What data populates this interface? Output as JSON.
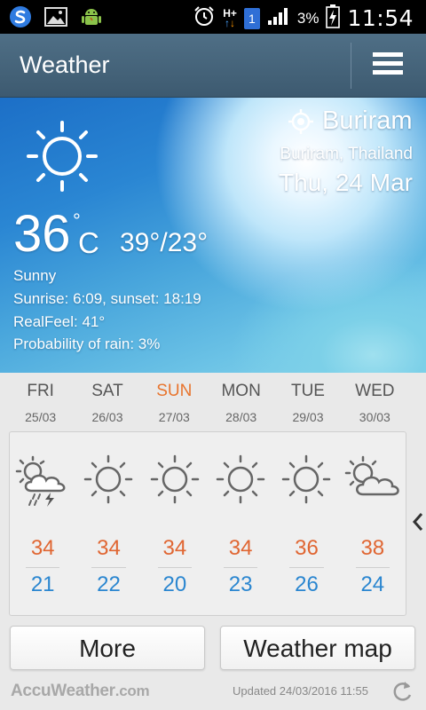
{
  "status_bar": {
    "battery": "3%",
    "time": "11:54",
    "network": "H+",
    "sim": "1",
    "icons": [
      "s-app-icon",
      "gallery-icon",
      "android-icon",
      "alarm-icon",
      "signal-icon",
      "battery-charging-icon"
    ]
  },
  "appbar": {
    "title": "Weather",
    "menu_icon": "hamburger-menu-icon"
  },
  "current": {
    "city": "Buriram",
    "region": "Buriram, Thailand",
    "date": "Thu, 24 Mar",
    "temp": "36",
    "temp_deg": "°",
    "unit": "C",
    "hilo": "39°/23°",
    "condition": "Sunny",
    "sunrise_sunset": "Sunrise: 6:09, sunset: 18:19",
    "realfeel": "RealFeel: 41°",
    "rain": "Probability of rain: 3%",
    "icon": "sun-icon"
  },
  "forecast": [
    {
      "day": "FRI",
      "date": "25/03",
      "icon": "thunderstorm-icon",
      "high": "34",
      "low": "21",
      "weekend": false
    },
    {
      "day": "SAT",
      "date": "26/03",
      "icon": "sun-icon",
      "high": "34",
      "low": "22",
      "weekend": false
    },
    {
      "day": "SUN",
      "date": "27/03",
      "icon": "sun-icon",
      "high": "34",
      "low": "20",
      "weekend": true
    },
    {
      "day": "MON",
      "date": "28/03",
      "icon": "sun-icon",
      "high": "34",
      "low": "23",
      "weekend": false
    },
    {
      "day": "TUE",
      "date": "29/03",
      "icon": "sun-icon",
      "high": "36",
      "low": "26",
      "weekend": false
    },
    {
      "day": "WED",
      "date": "30/03",
      "icon": "partly-cloudy-icon",
      "high": "38",
      "low": "24",
      "weekend": false
    }
  ],
  "buttons": {
    "more": "More",
    "map": "Weather map"
  },
  "footer": {
    "brand": "AccuWeather",
    "brand_suffix": ".com",
    "updated": "Updated 24/03/2016 11:55"
  },
  "colors": {
    "high": "#e06632",
    "low": "#2a86d0",
    "weekend": "#e8742d",
    "appbar": "#456379"
  }
}
